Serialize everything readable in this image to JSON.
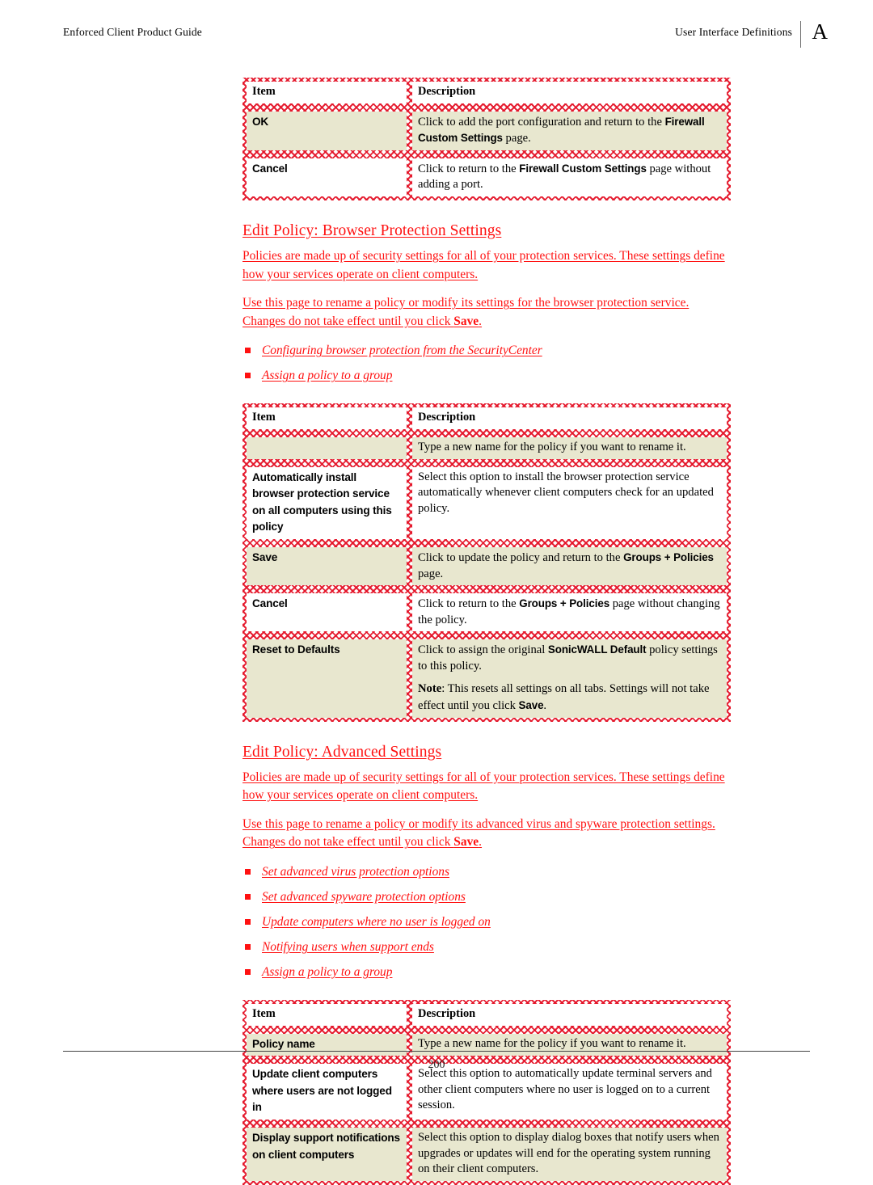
{
  "header": {
    "left": "Enforced Client Product Guide",
    "right": "User Interface Definitions",
    "letter": "A"
  },
  "footer": {
    "page_number": "200"
  },
  "colors": {
    "revision_text": "#ff1111",
    "cell_shading": "#e8e7cf",
    "table_border_hatch": "#e41226"
  },
  "tables": {
    "firewall_port": {
      "headers": {
        "item": "Item",
        "description": "Description"
      },
      "rows": [
        {
          "item": "OK",
          "item_shaded": true,
          "desc_shaded": true,
          "desc_parts": [
            {
              "t": "Click to add the port configuration and return to the ",
              "b": false
            },
            {
              "t": "Firewall Custom Settings",
              "b": true
            },
            {
              "t": " page.",
              "b": false
            }
          ]
        },
        {
          "item": "Cancel",
          "item_shaded": false,
          "desc_shaded": false,
          "desc_parts": [
            {
              "t": "Click to return to the ",
              "b": false
            },
            {
              "t": "Firewall Custom Settings",
              "b": true
            },
            {
              "t": " page without adding a port.",
              "b": false
            }
          ]
        }
      ]
    },
    "browser_protection": {
      "headers": {
        "item": "Item",
        "description": "Description"
      },
      "rows": [
        {
          "item": "",
          "item_shaded": true,
          "desc_shaded": true,
          "desc_parts": [
            {
              "t": "Type a new name for the policy if you want to rename it.",
              "b": false
            }
          ]
        },
        {
          "item": "Automatically install browser protection service on all computers using this policy",
          "item_shaded": false,
          "desc_shaded": false,
          "desc_parts": [
            {
              "t": "Select this option to install the browser protection service automatically whenever client computers check for an updated policy.",
              "b": false
            }
          ]
        },
        {
          "item": "Save",
          "item_shaded": true,
          "desc_shaded": true,
          "desc_parts": [
            {
              "t": "Click to update the policy and return to the ",
              "b": false
            },
            {
              "t": "Groups + Policies",
              "b": true
            },
            {
              "t": " page.",
              "b": false
            }
          ]
        },
        {
          "item": "Cancel",
          "item_shaded": false,
          "desc_shaded": false,
          "desc_parts": [
            {
              "t": "Click to return to the ",
              "b": false
            },
            {
              "t": "Groups + Policies",
              "b": true
            },
            {
              "t": " page without changing the policy.",
              "b": false
            }
          ]
        },
        {
          "item": "Reset to Defaults",
          "item_shaded": true,
          "desc_shaded": true,
          "desc_parts": [
            {
              "t": "Click to assign the original ",
              "b": false
            },
            {
              "t": "SonicWALL Default",
              "b": true
            },
            {
              "t": " policy settings to this policy.",
              "b": false
            }
          ],
          "desc_note_parts": [
            {
              "t": "Note",
              "b": false,
              "note": true
            },
            {
              "t": ": This resets all settings on all tabs. Settings will not take effect until you click ",
              "b": false
            },
            {
              "t": "Save",
              "b": true
            },
            {
              "t": ".",
              "b": false
            }
          ]
        }
      ]
    },
    "advanced_settings": {
      "headers": {
        "item": "Item",
        "description": "Description"
      },
      "rows": [
        {
          "item": "Policy name",
          "item_shaded": true,
          "desc_shaded": true,
          "desc_parts": [
            {
              "t": "Type a new name for the policy if you want to rename it.",
              "b": false
            }
          ]
        },
        {
          "item": "Update client computers where users are not logged in",
          "item_shaded": false,
          "desc_shaded": false,
          "desc_parts": [
            {
              "t": "Select this option to automatically update terminal servers and other client computers where no user is logged on to a current session.",
              "b": false
            }
          ]
        },
        {
          "item": "Display support notifications on client computers",
          "item_shaded": true,
          "desc_shaded": true,
          "desc_parts": [
            {
              "t": "Select this option to display dialog boxes that notify users when upgrades or updates will end for the operating system running on their client computers.",
              "b": false
            }
          ]
        }
      ]
    }
  },
  "sections": [
    {
      "id": "browser",
      "heading": "Edit Policy: Browser Protection Settings",
      "para1": "Policies are made up of security settings for all of your protection services. These settings define how your services operate on client computers.",
      "para2_pre": "Use this page to rename a policy or modify its settings for the browser protection service. Changes do not take effect until you click ",
      "para2_bold": "Save",
      "para2_post": ".",
      "links": [
        "Configuring browser protection from the SecurityCenter",
        "Assign a policy to a group"
      ]
    },
    {
      "id": "advanced",
      "heading": "Edit Policy: Advanced Settings",
      "para1": "Policies are made up of security settings for all of your protection services. These settings define how your services operate on client computers.",
      "para2_pre": "Use this page to rename a policy or modify its advanced virus and spyware protection settings. Changes do not take effect until you click ",
      "para2_bold": "Save",
      "para2_post": ".",
      "links": [
        "Set advanced virus protection options",
        "Set advanced spyware protection options",
        "Update computers where no user is logged on",
        "Notifying users when support ends",
        "Assign a policy to a group"
      ]
    }
  ]
}
